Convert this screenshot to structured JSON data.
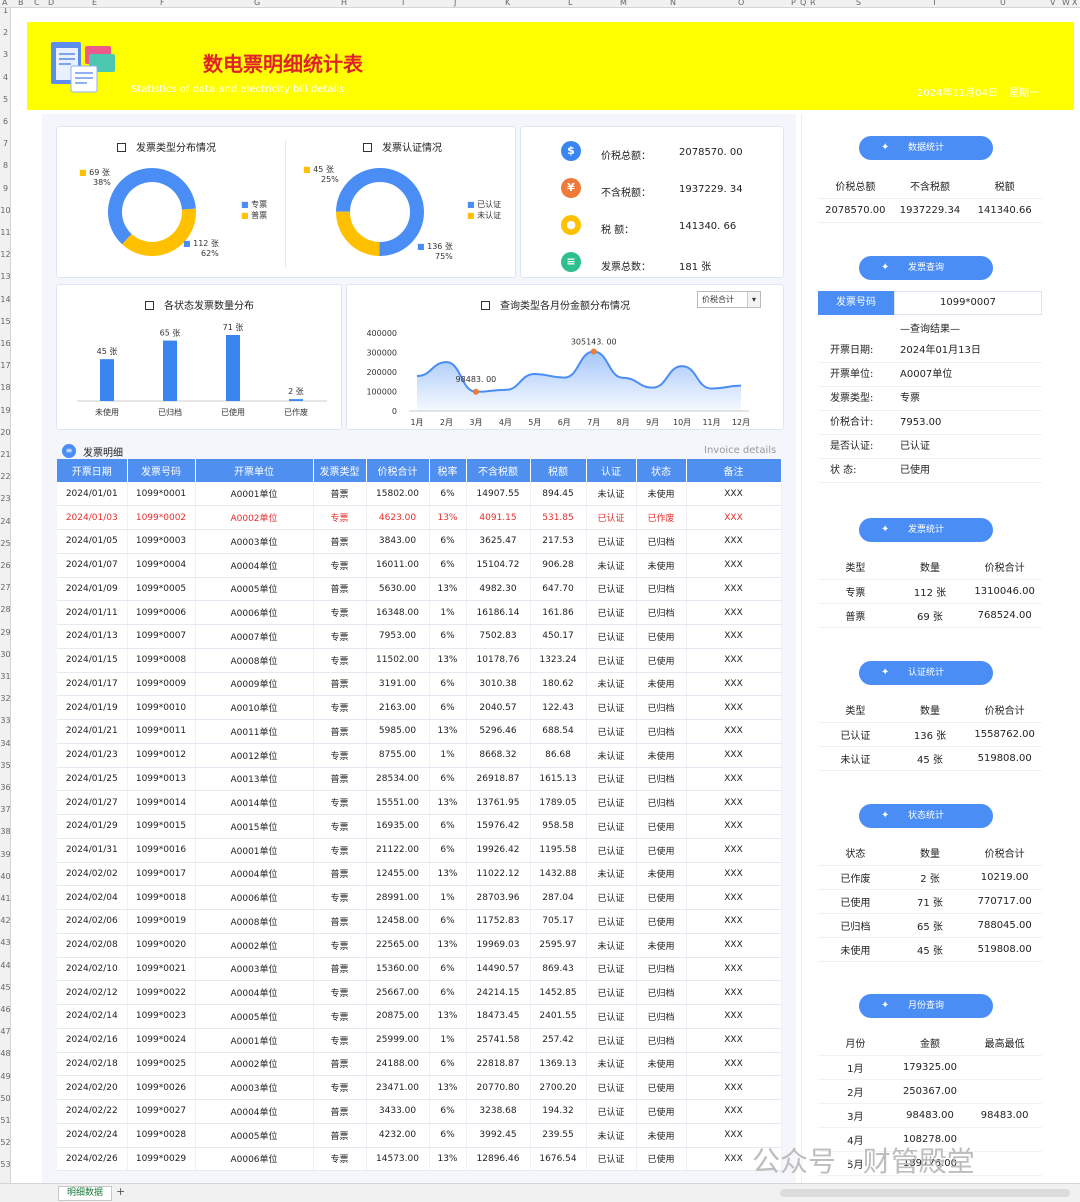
{
  "columns": [
    "A",
    "B",
    "C",
    "D",
    "E",
    "F",
    "G",
    "H",
    "I",
    "J",
    "K",
    "L",
    "M",
    "N",
    "O",
    "P",
    "Q",
    "R",
    "S",
    "T",
    "U",
    "V",
    "W",
    "X"
  ],
  "rows": [
    "1",
    "2",
    "3",
    "4",
    "5",
    "6",
    "7",
    "8",
    "9",
    "10",
    "11",
    "12",
    "13",
    "14",
    "15",
    "16",
    "17",
    "18",
    "19",
    "20",
    "21",
    "22",
    "23",
    "24",
    "25",
    "26",
    "27",
    "28",
    "29",
    "30",
    "31",
    "32",
    "33",
    "34",
    "35",
    "36",
    "37",
    "38",
    "39",
    "40",
    "41",
    "42",
    "43",
    "44",
    "45",
    "46",
    "47",
    "48",
    "49",
    "50",
    "51",
    "52",
    "53"
  ],
  "header": {
    "title": "数电票明细统计表",
    "subtitle": "Statistics of data and electricity bill details",
    "date": "2024年11月04日",
    "weekday": "星期一"
  },
  "donut1": {
    "title": "发票类型分布情况",
    "legend": [
      "专票",
      "普票"
    ],
    "label_a": "69 张",
    "label_a_pct": "38%",
    "label_b": "112 张",
    "label_b_pct": "62%",
    "colors": [
      "#4a8ef5",
      "#ffc000"
    ],
    "values": [
      112,
      69
    ]
  },
  "donut2": {
    "title": "发票认证情况",
    "legend": [
      "已认证",
      "未认证"
    ],
    "label_a": "45 张",
    "label_a_pct": "25%",
    "label_b": "136 张",
    "label_b_pct": "75%",
    "colors": [
      "#4a8ef5",
      "#ffc000"
    ],
    "values": [
      136,
      45
    ]
  },
  "kpi": {
    "total_label": "价税总额：",
    "total_value": "2078570. 00",
    "excl_label": "不含税额：",
    "excl_value": "1937229. 34",
    "tax_label": "税        额：",
    "tax_value": "141340. 66",
    "count_label": "发票总数：",
    "count_value": "181 张"
  },
  "bar_chart": {
    "title": "各状态发票数量分布",
    "value_labels": [
      "45 张",
      "65 张",
      "71 张",
      "2 张"
    ]
  },
  "line_chart": {
    "title": "查询类型各月份金额分布情况",
    "dropdown": "价税合计",
    "peak_label": "305143. 00",
    "low_label": "98483. 00"
  },
  "chart_data": [
    {
      "type": "bar",
      "title": "各状态发票数量分布",
      "categories": [
        "未使用",
        "已归档",
        "已使用",
        "已作废"
      ],
      "values": [
        45,
        65,
        71,
        2
      ],
      "color": "#3a86f0"
    },
    {
      "type": "area",
      "title": "查询类型各月份金额分布情况",
      "categories": [
        "1月",
        "2月",
        "3月",
        "4月",
        "5月",
        "6月",
        "7月",
        "8月",
        "9月",
        "10月",
        "11月",
        "12月"
      ],
      "values": [
        179325,
        250367,
        98483,
        108278,
        189776,
        171160,
        305143,
        170000,
        120000,
        230000,
        115000,
        130000
      ],
      "yticks": [
        "400000",
        "300000",
        "200000",
        "100000",
        "0"
      ],
      "ylim": [
        0,
        400000
      ],
      "color": "#4a8ef5"
    }
  ],
  "detail": {
    "title": "发票明细",
    "title_en": "Invoice details",
    "columns": [
      "开票日期",
      "发票号码",
      "开票单位",
      "发票类型",
      "价税合计",
      "税率",
      "不含税额",
      "税额",
      "认证",
      "状态",
      "备注"
    ],
    "rows": [
      [
        "2024/01/01",
        "1099*0001",
        "A0001单位",
        "普票",
        "15802.00",
        "6%",
        "14907.55",
        "894.45",
        "未认证",
        "未使用",
        "XXX"
      ],
      [
        "2024/01/03",
        "1099*0002",
        "A0002单位",
        "专票",
        "4623.00",
        "13%",
        "4091.15",
        "531.85",
        "已认证",
        "已作废",
        "XXX"
      ],
      [
        "2024/01/05",
        "1099*0003",
        "A0003单位",
        "普票",
        "3843.00",
        "6%",
        "3625.47",
        "217.53",
        "已认证",
        "已归档",
        "XXX"
      ],
      [
        "2024/01/07",
        "1099*0004",
        "A0004单位",
        "专票",
        "16011.00",
        "6%",
        "15104.72",
        "906.28",
        "未认证",
        "未使用",
        "XXX"
      ],
      [
        "2024/01/09",
        "1099*0005",
        "A0005单位",
        "普票",
        "5630.00",
        "13%",
        "4982.30",
        "647.70",
        "已认证",
        "已归档",
        "XXX"
      ],
      [
        "2024/01/11",
        "1099*0006",
        "A0006单位",
        "专票",
        "16348.00",
        "1%",
        "16186.14",
        "161.86",
        "已认证",
        "已归档",
        "XXX"
      ],
      [
        "2024/01/13",
        "1099*0007",
        "A0007单位",
        "专票",
        "7953.00",
        "6%",
        "7502.83",
        "450.17",
        "已认证",
        "已使用",
        "XXX"
      ],
      [
        "2024/01/15",
        "1099*0008",
        "A0008单位",
        "专票",
        "11502.00",
        "13%",
        "10178.76",
        "1323.24",
        "已认证",
        "已使用",
        "XXX"
      ],
      [
        "2024/01/17",
        "1099*0009",
        "A0009单位",
        "普票",
        "3191.00",
        "6%",
        "3010.38",
        "180.62",
        "未认证",
        "未使用",
        "XXX"
      ],
      [
        "2024/01/19",
        "1099*0010",
        "A0010单位",
        "专票",
        "2163.00",
        "6%",
        "2040.57",
        "122.43",
        "已认证",
        "已归档",
        "XXX"
      ],
      [
        "2024/01/21",
        "1099*0011",
        "A0011单位",
        "普票",
        "5985.00",
        "13%",
        "5296.46",
        "688.54",
        "已认证",
        "已归档",
        "XXX"
      ],
      [
        "2024/01/23",
        "1099*0012",
        "A0012单位",
        "专票",
        "8755.00",
        "1%",
        "8668.32",
        "86.68",
        "未认证",
        "未使用",
        "XXX"
      ],
      [
        "2024/01/25",
        "1099*0013",
        "A0013单位",
        "普票",
        "28534.00",
        "6%",
        "26918.87",
        "1615.13",
        "已认证",
        "已归档",
        "XXX"
      ],
      [
        "2024/01/27",
        "1099*0014",
        "A0014单位",
        "专票",
        "15551.00",
        "13%",
        "13761.95",
        "1789.05",
        "已认证",
        "已归档",
        "XXX"
      ],
      [
        "2024/01/29",
        "1099*0015",
        "A0015单位",
        "专票",
        "16935.00",
        "6%",
        "15976.42",
        "958.58",
        "已认证",
        "已使用",
        "XXX"
      ],
      [
        "2024/01/31",
        "1099*0016",
        "A0001单位",
        "专票",
        "21122.00",
        "6%",
        "19926.42",
        "1195.58",
        "已认证",
        "已使用",
        "XXX"
      ],
      [
        "2024/02/02",
        "1099*0017",
        "A0004单位",
        "普票",
        "12455.00",
        "13%",
        "11022.12",
        "1432.88",
        "未认证",
        "未使用",
        "XXX"
      ],
      [
        "2024/02/04",
        "1099*0018",
        "A0006单位",
        "专票",
        "28991.00",
        "1%",
        "28703.96",
        "287.04",
        "已认证",
        "已使用",
        "XXX"
      ],
      [
        "2024/02/06",
        "1099*0019",
        "A0008单位",
        "普票",
        "12458.00",
        "6%",
        "11752.83",
        "705.17",
        "已认证",
        "已使用",
        "XXX"
      ],
      [
        "2024/02/08",
        "1099*0020",
        "A0002单位",
        "专票",
        "22565.00",
        "13%",
        "19969.03",
        "2595.97",
        "未认证",
        "未使用",
        "XXX"
      ],
      [
        "2024/02/10",
        "1099*0021",
        "A0003单位",
        "普票",
        "15360.00",
        "6%",
        "14490.57",
        "869.43",
        "已认证",
        "已归档",
        "XXX"
      ],
      [
        "2024/02/12",
        "1099*0022",
        "A0004单位",
        "专票",
        "25667.00",
        "6%",
        "24214.15",
        "1452.85",
        "已认证",
        "已归档",
        "XXX"
      ],
      [
        "2024/02/14",
        "1099*0023",
        "A0005单位",
        "专票",
        "20875.00",
        "13%",
        "18473.45",
        "2401.55",
        "已认证",
        "已归档",
        "XXX"
      ],
      [
        "2024/02/16",
        "1099*0024",
        "A0001单位",
        "专票",
        "25999.00",
        "1%",
        "25741.58",
        "257.42",
        "已认证",
        "已归档",
        "XXX"
      ],
      [
        "2024/02/18",
        "1099*0025",
        "A0002单位",
        "普票",
        "24188.00",
        "6%",
        "22818.87",
        "1369.13",
        "未认证",
        "未使用",
        "XXX"
      ],
      [
        "2024/02/20",
        "1099*0026",
        "A0003单位",
        "专票",
        "23471.00",
        "13%",
        "20770.80",
        "2700.20",
        "已认证",
        "已使用",
        "XXX"
      ],
      [
        "2024/02/22",
        "1099*0027",
        "A0004单位",
        "普票",
        "3433.00",
        "6%",
        "3238.68",
        "194.32",
        "已认证",
        "已使用",
        "XXX"
      ],
      [
        "2024/02/24",
        "1099*0028",
        "A0005单位",
        "普票",
        "4232.00",
        "6%",
        "3992.45",
        "239.55",
        "未认证",
        "未使用",
        "XXX"
      ],
      [
        "2024/02/26",
        "1099*0029",
        "A0006单位",
        "专票",
        "14573.00",
        "13%",
        "12896.46",
        "1676.54",
        "已认证",
        "已使用",
        "XXX"
      ]
    ]
  },
  "right": {
    "stats_btn": "数据统计",
    "stats_head": [
      "价税总额",
      "不含税额",
      "税额"
    ],
    "stats_vals": [
      "2078570.00",
      "1937229.34",
      "141340.66"
    ],
    "query_btn": "发票查询",
    "query_key_label": "发票号码",
    "query_key_value": "1099*0007",
    "query_result_title": "—查询结果—",
    "query_rows": [
      [
        "开票日期:",
        "2024年01月13日"
      ],
      [
        "开票单位:",
        "A0007单位"
      ],
      [
        "发票类型:",
        "专票"
      ],
      [
        "价税合计:",
        "7953.00"
      ],
      [
        "是否认证:",
        "已认证"
      ],
      [
        "状      态:",
        "已使用"
      ]
    ],
    "type_btn": "发票统计",
    "type_head": [
      "类型",
      "数量",
      "价税合计"
    ],
    "type_rows": [
      [
        "专票",
        "112 张",
        "1310046.00"
      ],
      [
        "普票",
        "69 张",
        "768524.00"
      ]
    ],
    "auth_btn": "认证统计",
    "auth_head": [
      "类型",
      "数量",
      "价税合计"
    ],
    "auth_rows": [
      [
        "已认证",
        "136 张",
        "1558762.00"
      ],
      [
        "未认证",
        "45 张",
        "519808.00"
      ]
    ],
    "status_btn": "状态统计",
    "status_head": [
      "状态",
      "数量",
      "价税合计"
    ],
    "status_rows": [
      [
        "已作废",
        "2 张",
        "10219.00"
      ],
      [
        "已使用",
        "71 张",
        "770717.00"
      ],
      [
        "已归档",
        "65 张",
        "788045.00"
      ],
      [
        "未使用",
        "45 张",
        "519808.00"
      ]
    ],
    "month_btn": "月份查询",
    "month_head": [
      "月份",
      "金额",
      "最高最低"
    ],
    "month_rows": [
      [
        "1月",
        "179325.00",
        ""
      ],
      [
        "2月",
        "250367.00",
        ""
      ],
      [
        "3月",
        "98483.00",
        "98483.00"
      ],
      [
        "4月",
        "108278.00",
        ""
      ],
      [
        "5月",
        "189776.00",
        ""
      ]
    ]
  },
  "sheet_tab": "明细数据",
  "watermark": "公众号 · 财管殿堂"
}
